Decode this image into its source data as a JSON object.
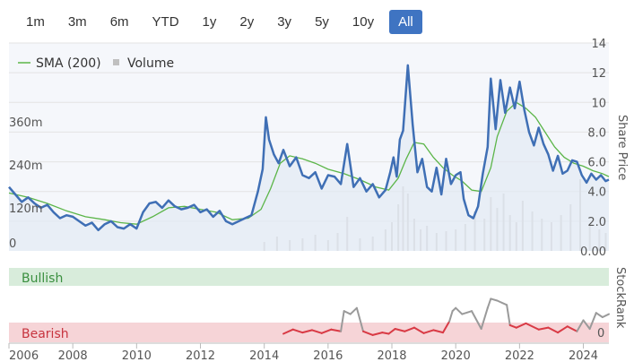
{
  "range_selector": {
    "buttons": [
      "1m",
      "3m",
      "6m",
      "YTD",
      "1y",
      "2y",
      "3y",
      "5y",
      "10y",
      "All"
    ],
    "selected": "All"
  },
  "colors": {
    "price": "#3f6fb5",
    "sma": "#5bb548",
    "volume": "#c8c8c8",
    "bullish_band": "#d8ecdb",
    "bearish_band": "#f6d4d7",
    "rank_bearish": "#d93a45",
    "rank_other": "#9a9a9a",
    "active_button": "#3f74c2"
  },
  "chart_data": {
    "type": "line",
    "legend": {
      "position": "top-left",
      "items": [
        "SMA (200)",
        "Volume"
      ]
    },
    "x_ticks": [
      "2006",
      "2008",
      "2010",
      "2012",
      "2014",
      "2016",
      "2018",
      "2020",
      "2022",
      "2024"
    ],
    "xlim": [
      2006.0,
      2024.8
    ],
    "price_axis": {
      "title": "Share Price",
      "ticks": [
        "0.00",
        "2.0",
        "4.0",
        "6.0",
        "8.0",
        "10",
        "12",
        "14"
      ],
      "ylim": [
        0,
        14
      ]
    },
    "volume_axis": {
      "ticks": [
        "0",
        "120m",
        "240m",
        "360m"
      ],
      "ylim": [
        0,
        580
      ]
    },
    "rank_axis": {
      "title": "StockRank",
      "ticks": [
        "0"
      ]
    },
    "bands": {
      "bullish": "Bullish",
      "bearish": "Bearish"
    },
    "series": [
      {
        "name": "Share Price",
        "x": [
          2006.0,
          2006.2,
          2006.4,
          2006.6,
          2006.8,
          2007.0,
          2007.2,
          2007.4,
          2007.6,
          2007.8,
          2008.0,
          2008.2,
          2008.4,
          2008.6,
          2008.8,
          2009.0,
          2009.2,
          2009.4,
          2009.6,
          2009.8,
          2010.0,
          2010.2,
          2010.4,
          2010.6,
          2010.8,
          2011.0,
          2011.2,
          2011.4,
          2011.6,
          2011.8,
          2012.0,
          2012.2,
          2012.4,
          2012.6,
          2012.8,
          2013.0,
          2013.2,
          2013.4,
          2013.6,
          2013.8,
          2013.95,
          2014.05,
          2014.15,
          2014.3,
          2014.45,
          2014.6,
          2014.8,
          2015.0,
          2015.2,
          2015.4,
          2015.6,
          2015.8,
          2016.0,
          2016.2,
          2016.4,
          2016.6,
          2016.8,
          2017.0,
          2017.2,
          2017.4,
          2017.6,
          2017.8,
          2017.95,
          2018.05,
          2018.15,
          2018.25,
          2018.35,
          2018.5,
          2018.65,
          2018.8,
          2018.95,
          2019.1,
          2019.25,
          2019.4,
          2019.55,
          2019.7,
          2019.85,
          2020.0,
          2020.15,
          2020.25,
          2020.4,
          2020.55,
          2020.7,
          2020.85,
          2021.0,
          2021.1,
          2021.25,
          2021.4,
          2021.55,
          2021.7,
          2021.85,
          2022.0,
          2022.15,
          2022.3,
          2022.45,
          2022.6,
          2022.75,
          2022.9,
          2023.05,
          2023.2,
          2023.35,
          2023.5,
          2023.65,
          2023.8,
          2023.95,
          2024.1,
          2024.25,
          2024.4,
          2024.55,
          2024.7,
          2024.8
        ],
        "y": [
          4.3,
          3.8,
          3.3,
          3.6,
          3.2,
          2.9,
          3.1,
          2.6,
          2.2,
          2.4,
          2.3,
          2.0,
          1.7,
          1.9,
          1.4,
          1.8,
          2.0,
          1.6,
          1.5,
          1.8,
          1.5,
          2.6,
          3.2,
          3.3,
          2.9,
          3.4,
          3.0,
          2.8,
          2.9,
          3.1,
          2.6,
          2.8,
          2.3,
          2.7,
          2.0,
          1.8,
          2.0,
          2.2,
          2.4,
          4.0,
          5.5,
          9.0,
          7.5,
          6.5,
          5.9,
          6.8,
          5.7,
          6.3,
          5.1,
          4.9,
          5.3,
          4.2,
          5.1,
          5.0,
          4.5,
          7.2,
          4.3,
          4.9,
          4.0,
          4.5,
          3.6,
          4.1,
          5.3,
          6.3,
          5.0,
          7.5,
          8.1,
          12.5,
          8.5,
          5.3,
          6.2,
          4.3,
          4.0,
          5.6,
          3.8,
          6.2,
          4.5,
          5.1,
          5.3,
          3.5,
          2.4,
          2.2,
          3.0,
          5.2,
          7.0,
          11.6,
          8.2,
          11.5,
          9.3,
          11.0,
          9.6,
          11.4,
          9.5,
          8.0,
          7.1,
          8.3,
          7.2,
          6.5,
          5.4,
          6.4,
          5.2,
          5.4,
          6.1,
          6.0,
          5.1,
          4.6,
          5.2,
          4.8,
          5.1,
          4.7,
          4.8
        ]
      },
      {
        "name": "SMA (200)",
        "x": [
          2006.0,
          2006.6,
          2007.2,
          2007.8,
          2008.4,
          2009.0,
          2009.5,
          2010.0,
          2010.5,
          2011.0,
          2011.5,
          2012.0,
          2012.5,
          2013.0,
          2013.5,
          2013.9,
          2014.2,
          2014.5,
          2014.8,
          2015.2,
          2015.6,
          2016.0,
          2016.5,
          2017.0,
          2017.5,
          2017.9,
          2018.2,
          2018.45,
          2018.7,
          2019.0,
          2019.3,
          2019.6,
          2019.9,
          2020.2,
          2020.5,
          2020.8,
          2021.1,
          2021.3,
          2021.6,
          2021.9,
          2022.2,
          2022.5,
          2022.8,
          2023.1,
          2023.4,
          2023.7,
          2024.0,
          2024.3,
          2024.6,
          2024.8
        ],
        "y": [
          3.9,
          3.6,
          3.2,
          2.7,
          2.3,
          2.1,
          1.9,
          1.8,
          2.3,
          2.9,
          3.0,
          2.8,
          2.6,
          2.1,
          2.2,
          2.8,
          4.2,
          5.9,
          6.4,
          6.2,
          5.9,
          5.5,
          5.2,
          4.8,
          4.3,
          4.1,
          4.9,
          6.2,
          7.3,
          7.2,
          6.3,
          5.6,
          5.1,
          4.7,
          4.1,
          4.0,
          5.6,
          7.7,
          9.4,
          10.0,
          9.6,
          9.0,
          8.0,
          7.0,
          6.3,
          5.9,
          5.7,
          5.4,
          5.2,
          5.0
        ]
      }
    ],
    "volume_series": {
      "name": "Volume",
      "x": [
        2014.0,
        2014.4,
        2014.8,
        2015.2,
        2015.6,
        2016.0,
        2016.3,
        2016.6,
        2017.0,
        2017.4,
        2017.8,
        2018.0,
        2018.2,
        2018.35,
        2018.5,
        2018.7,
        2018.9,
        2019.1,
        2019.4,
        2019.7,
        2020.0,
        2020.3,
        2020.6,
        2020.9,
        2021.1,
        2021.3,
        2021.5,
        2021.7,
        2021.9,
        2022.1,
        2022.4,
        2022.7,
        2023.0,
        2023.3,
        2023.6,
        2023.9,
        2024.2,
        2024.5,
        2024.7
      ],
      "values": [
        25,
        40,
        30,
        35,
        45,
        30,
        50,
        95,
        35,
        40,
        60,
        80,
        130,
        180,
        160,
        90,
        60,
        70,
        50,
        55,
        60,
        75,
        110,
        90,
        150,
        120,
        160,
        100,
        80,
        140,
        110,
        90,
        80,
        100,
        130,
        200,
        70,
        60,
        50
      ]
    },
    "stockrank": {
      "name": "StockRank",
      "x": [
        2014.6,
        2014.9,
        2015.2,
        2015.5,
        2015.8,
        2016.1,
        2016.4,
        2016.5,
        2016.7,
        2016.9,
        2017.1,
        2017.4,
        2017.7,
        2017.9,
        2018.1,
        2018.4,
        2018.7,
        2019.0,
        2019.3,
        2019.6,
        2019.8,
        2019.9,
        2020.0,
        2020.2,
        2020.5,
        2020.8,
        2021.0,
        2021.1,
        2021.3,
        2021.6,
        2021.7,
        2021.9,
        2022.2,
        2022.6,
        2022.9,
        2023.2,
        2023.5,
        2023.8,
        2024.0,
        2024.2,
        2024.4,
        2024.6,
        2024.8
      ],
      "values": [
        8,
        15,
        10,
        14,
        9,
        15,
        12,
        45,
        40,
        50,
        12,
        6,
        10,
        8,
        16,
        12,
        18,
        9,
        14,
        10,
        28,
        45,
        50,
        40,
        45,
        16,
        50,
        65,
        62,
        55,
        22,
        18,
        25,
        15,
        18,
        10,
        20,
        12,
        30,
        16,
        42,
        35,
        40
      ],
      "bearish_threshold": 30
    }
  }
}
